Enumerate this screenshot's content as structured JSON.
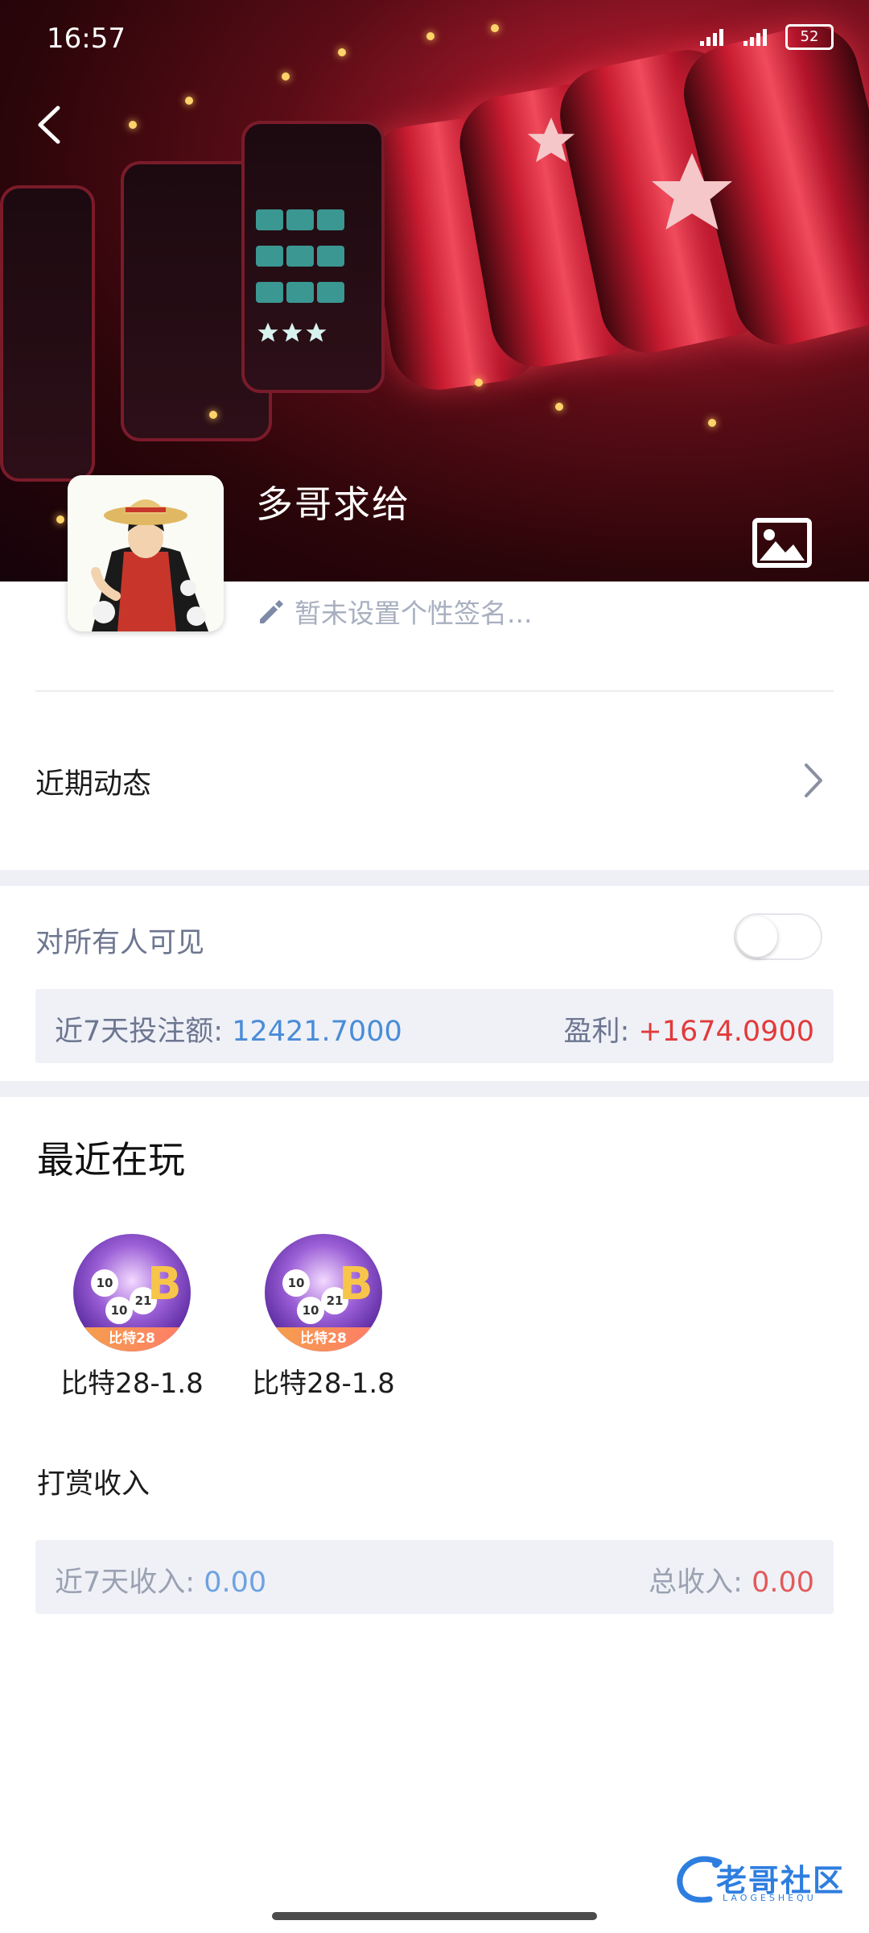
{
  "status_bar": {
    "time": "16:57",
    "battery": "52"
  },
  "profile": {
    "username": "多哥求给",
    "signature_placeholder": "暂未设置个性签名..."
  },
  "recent_activity": {
    "label": "近期动态"
  },
  "visibility": {
    "label": "对所有人可见",
    "enabled": false
  },
  "bet_stats": {
    "bet_label": "近7天投注额:",
    "bet_value": "12421.7000",
    "profit_label": "盈利:",
    "profit_value": "+1674.0900"
  },
  "recently_playing": {
    "title": "最近在玩",
    "games": [
      {
        "name": "比特28-1.8",
        "tag": "比特28"
      },
      {
        "name": "比特28-1.8",
        "tag": "比特28"
      }
    ]
  },
  "tips": {
    "title": "打赏收入",
    "week_label": "近7天收入:",
    "week_value": "0.00",
    "total_label": "总收入:",
    "total_value": "0.00"
  },
  "watermark": {
    "text": "老哥社区",
    "sub": "LAOGESHEQU"
  },
  "colors": {
    "blue_value": "#4a8cd8",
    "red_value": "#e23a3a",
    "band": "#eef0f6",
    "stat_bg": "#eff1f7"
  }
}
